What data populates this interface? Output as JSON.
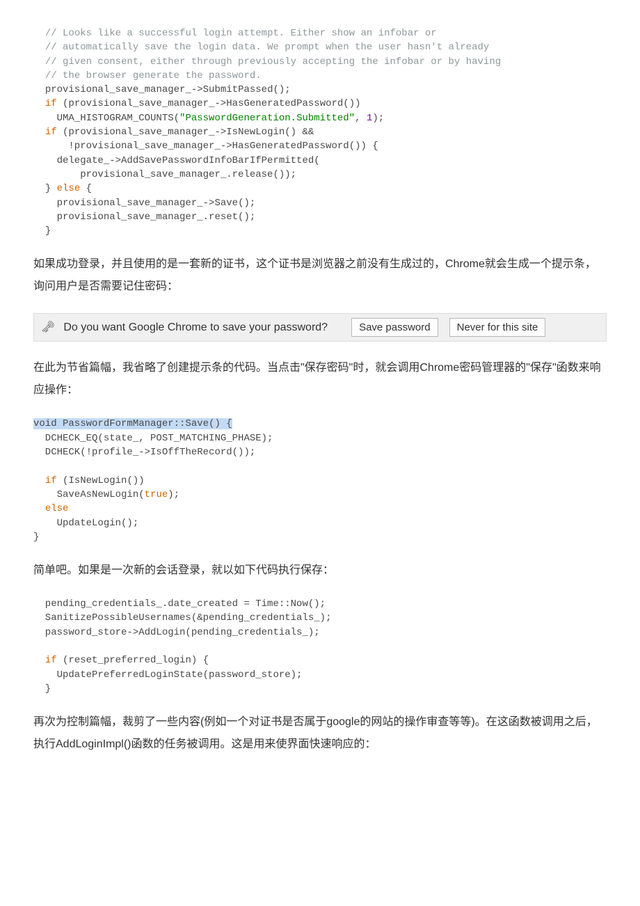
{
  "code1": {
    "indent": "  ",
    "c1": "// Looks like a successful login attempt. Either show an infobar or",
    "c2": "// automatically save the login data. We prompt when the user hasn't already",
    "c3": "// given consent, either through previously accepting the infobar or by having",
    "c4": "// the browser generate the password.",
    "l5a": "provisional_save_manager_->",
    "l5b": "SubmitPassed",
    "l5c": "();",
    "l6a": "if",
    "l6b": " (provisional_save_manager_->",
    "l6c": "HasGeneratedPassword",
    "l6d": "())",
    "l7a": "    UMA_HISTOGRAM_COUNTS(",
    "l7b": "\"PasswordGeneration.Submitted\"",
    "l7c": ", ",
    "l7d": "1",
    "l7e": ");",
    "l8a": "if",
    "l8b": " (provisional_save_manager_->",
    "l8c": "IsNewLogin",
    "l8d": "() &&",
    "l9a": "      !provisional_save_manager_->",
    "l9b": "HasGeneratedPassword",
    "l9c": "()) {",
    "l10": "    delegate_->AddSavePasswordInfoBarIfPermitted(",
    "l11": "        provisional_save_manager_.release());",
    "l12a": "} ",
    "l12b": "else",
    "l12c": " {",
    "l13a": "    provisional_save_manager_->",
    "l13b": "Save",
    "l13c": "();",
    "l14": "    provisional_save_manager_.reset();",
    "l15": "}"
  },
  "para1": "如果成功登录，并且使用的是一套新的证书，这个证书是浏览器之前没有生成过的，Chrome就会生成一个提示条，询问用户是否需要记住密码：",
  "infobar": {
    "icon_glyph": "🗝",
    "message": "Do you want Google Chrome to save your password?",
    "btn_save": "Save password",
    "btn_never": "Never for this site"
  },
  "para2": "在此为节省篇幅，我省略了创建提示条的代码。当点击\"保存密码\"时，就会调用Chrome密码管理器的\"保存\"函数来响应操作：",
  "code2": {
    "hl": "void PasswordFormManager::Save() {",
    "l2": "  DCHECK_EQ(state_, POST_MATCHING_PHASE);",
    "l3a": "  DCHECK(!profile_->",
    "l3b": "IsOffTheRecord",
    "l3c": "());",
    "blank": "",
    "l5a": "  ",
    "l5b": "if",
    "l5c": " (",
    "l5d": "IsNewLogin",
    "l5e": "())",
    "l6a": "    SaveAsNewLogin(",
    "l6b": "true",
    "l6c": ");",
    "l7a": "  ",
    "l7b": "else",
    "l8": "    UpdateLogin();",
    "l9": "}"
  },
  "para3": "简单吧。如果是一次新的会话登录，就以如下代码执行保存：",
  "code3": {
    "l1": "  pending_credentials_.date_created = Time::Now();",
    "l2": "  SanitizePossibleUsernames(&pending_credentials_);",
    "l3": "  password_store->AddLogin(pending_credentials_);",
    "blank": "",
    "l5a": "  ",
    "l5b": "if",
    "l5c": " (reset_preferred_login) {",
    "l6": "    UpdatePreferredLoginState(password_store);",
    "l7": "  }"
  },
  "para4": "再次为控制篇幅，裁剪了一些内容(例如一个对证书是否属于google的网站的操作审查等等)。在这函数被调用之后，执行AddLoginImpl()函数的任务被调用。这是用来使界面快速响应的："
}
